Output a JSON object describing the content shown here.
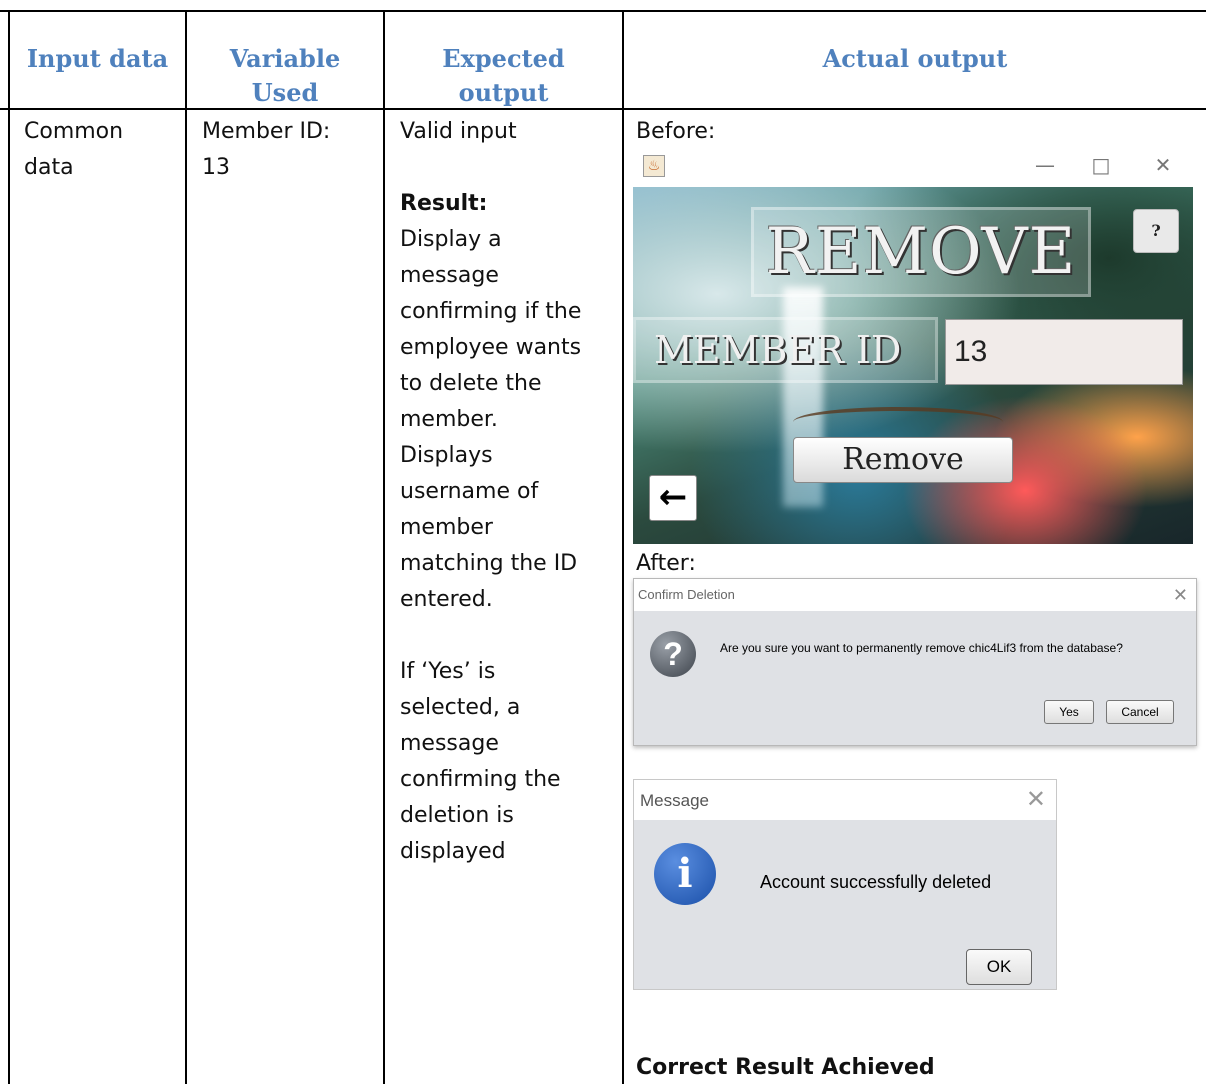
{
  "headers": {
    "input_data": "Input data",
    "variable_used_1": "Variable",
    "variable_used_2": "Used",
    "expected_output_1": "Expected",
    "expected_output_2": "output",
    "actual_output": "Actual output"
  },
  "row": {
    "input_data_1": "Common",
    "input_data_2": "data",
    "variable_1": "Member ID:",
    "variable_2": "13",
    "expected": {
      "line1": "Valid input",
      "result_label": "Result:",
      "lines_a": [
        "Display a",
        "message",
        "confirming if the",
        "employee wants",
        "to delete the",
        "member.",
        "Displays",
        "username of",
        "member",
        "matching the ID",
        "entered."
      ],
      "lines_b": [
        "If ‘Yes’ is",
        "selected, a",
        "message",
        "confirming the",
        "deletion is",
        "displayed"
      ]
    },
    "before_label": "Before:",
    "after_label": "After:",
    "conclusion": "Correct Result Achieved"
  },
  "remove_window": {
    "title": "REMOVE",
    "help": "?",
    "member_id_label": "MEMBER ID",
    "member_id_value": "13",
    "remove_button": "Remove",
    "back_arrow": "←",
    "minimize": "—",
    "maximize": "□",
    "close": "✕"
  },
  "confirm_dialog": {
    "title": "Confirm Deletion",
    "message": "Are you sure you want to permanently remove chic4Lif3 from the database?",
    "yes": "Yes",
    "cancel": "Cancel",
    "close": "✕",
    "icon": "question-icon"
  },
  "message_dialog": {
    "title": "Message",
    "message": "Account successfully deleted",
    "ok": "OK",
    "close": "✕",
    "icon": "info-icon"
  }
}
